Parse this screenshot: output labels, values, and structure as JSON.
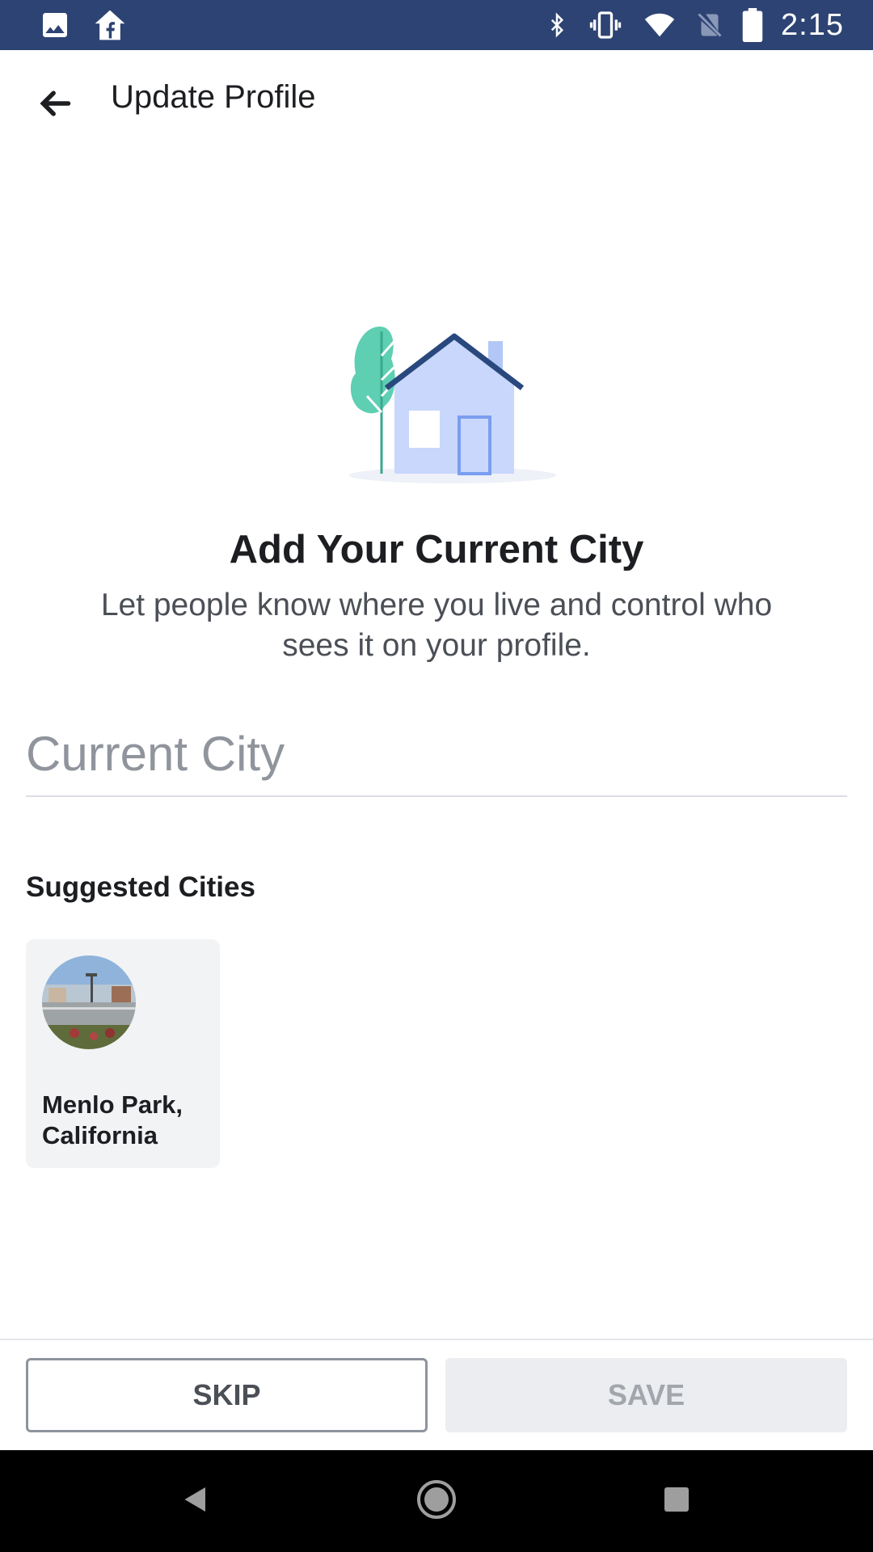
{
  "status_bar": {
    "time": "2:15",
    "left_icons": [
      "image-icon",
      "facebook-home-icon"
    ],
    "right_icons": [
      "bluetooth-icon",
      "vibrate-icon",
      "wifi-icon",
      "no-sim-icon",
      "battery-icon"
    ],
    "background": "#2d4373"
  },
  "app_bar": {
    "title": "Update Profile",
    "back_icon": "back-arrow-icon"
  },
  "main": {
    "illustration": "house-illustration",
    "headline": "Add Your Current City",
    "subtext": "Let people know where you live and control who sees it on your profile.",
    "city_input": {
      "value": "",
      "placeholder": "Current City"
    },
    "suggested_label": "Suggested Cities",
    "suggested_cities": [
      {
        "name": "Menlo Park, California",
        "image": "city-photo"
      }
    ]
  },
  "actions": {
    "skip_label": "SKIP",
    "save_label": "SAVE"
  },
  "nav_bar": {
    "buttons": [
      "back-triangle-icon",
      "home-circle-icon",
      "recents-square-icon"
    ]
  },
  "colors": {
    "primary_dark": "#2d4373",
    "teal_tree": "#5fcfb3",
    "house_light": "#c8d7fb",
    "house_roof": "#29487d"
  }
}
